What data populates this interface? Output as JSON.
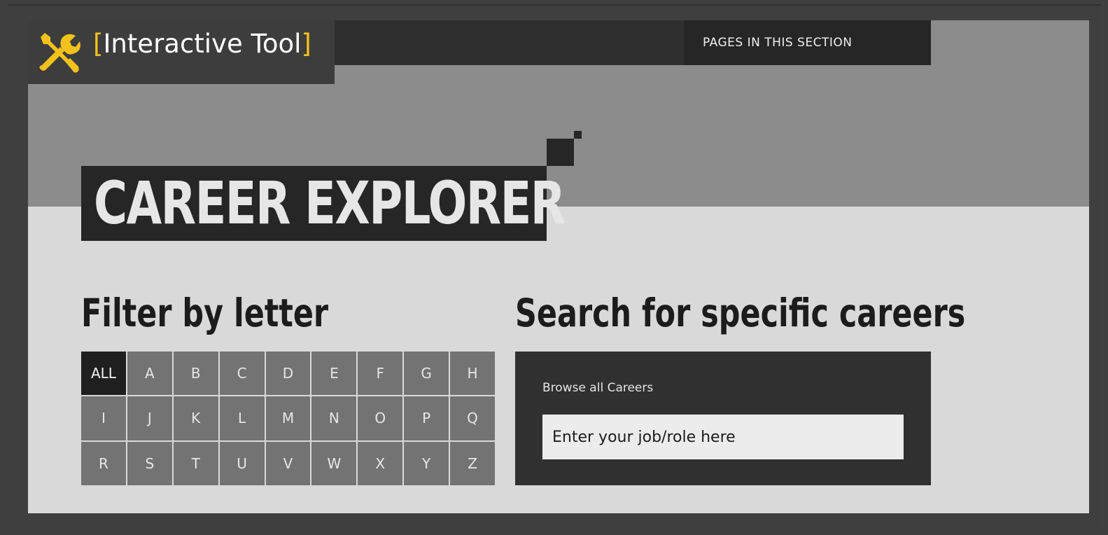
{
  "badge": {
    "open_bracket": "[",
    "label": "Interactive Tool",
    "close_bracket": "]",
    "icon": "tools-icon",
    "accent": "#f2c21a"
  },
  "topbar": {
    "pages_button": "PAGES IN THIS SECTION"
  },
  "hero": {
    "title": "CAREER EXPLORER"
  },
  "filter": {
    "heading": "Filter by letter",
    "letters": [
      "ALL",
      "A",
      "B",
      "C",
      "D",
      "E",
      "F",
      "G",
      "H",
      "I",
      "J",
      "K",
      "L",
      "M",
      "N",
      "O",
      "P",
      "Q",
      "R",
      "S",
      "T",
      "U",
      "V",
      "W",
      "X",
      "Y",
      "Z"
    ],
    "selected": "ALL"
  },
  "search": {
    "heading": "Search for specific careers",
    "browse_label": "Browse all Careers",
    "placeholder": "Enter your job/role here"
  }
}
